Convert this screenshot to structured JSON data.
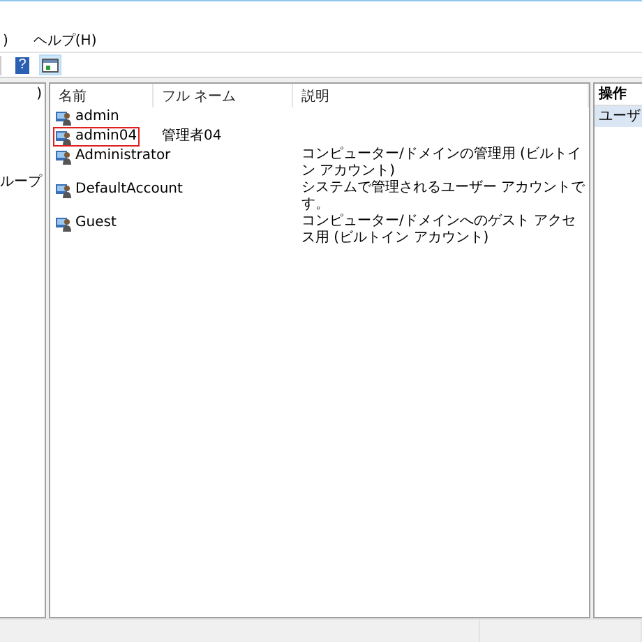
{
  "menu_bar": {
    "items": [
      ")",
      "ヘルプ(H)"
    ]
  },
  "toolbar": {
    "buttons": [
      {
        "kind": "help",
        "glyph": "?",
        "selected": false
      },
      {
        "kind": "pane",
        "selected": true
      }
    ]
  },
  "tree_pane": {
    "items": [
      ")",
      "ループ"
    ]
  },
  "table": {
    "columns": [
      "名前",
      "フル ネーム",
      "説明"
    ],
    "rows": [
      {
        "name": "admin",
        "full_name": "",
        "description": "",
        "highlighted": false
      },
      {
        "name": "admin04",
        "full_name": "管理者04",
        "description": "",
        "highlighted": true
      },
      {
        "name": "Administrator",
        "full_name": "",
        "description": "コンピューター/ドメインの管理用 (ビルトイン アカウント)",
        "highlighted": false
      },
      {
        "name": "DefaultAccount",
        "full_name": "",
        "description": "システムで管理されるユーザー アカウントです。",
        "highlighted": false
      },
      {
        "name": "Guest",
        "full_name": "",
        "description": "コンピューター/ドメインへのゲスト アクセス用 (ビルトイン アカウント)",
        "highlighted": false
      }
    ]
  },
  "actions_pane": {
    "title": "操作",
    "items": [
      {
        "label": "ユーザ",
        "selected": true
      }
    ]
  }
}
